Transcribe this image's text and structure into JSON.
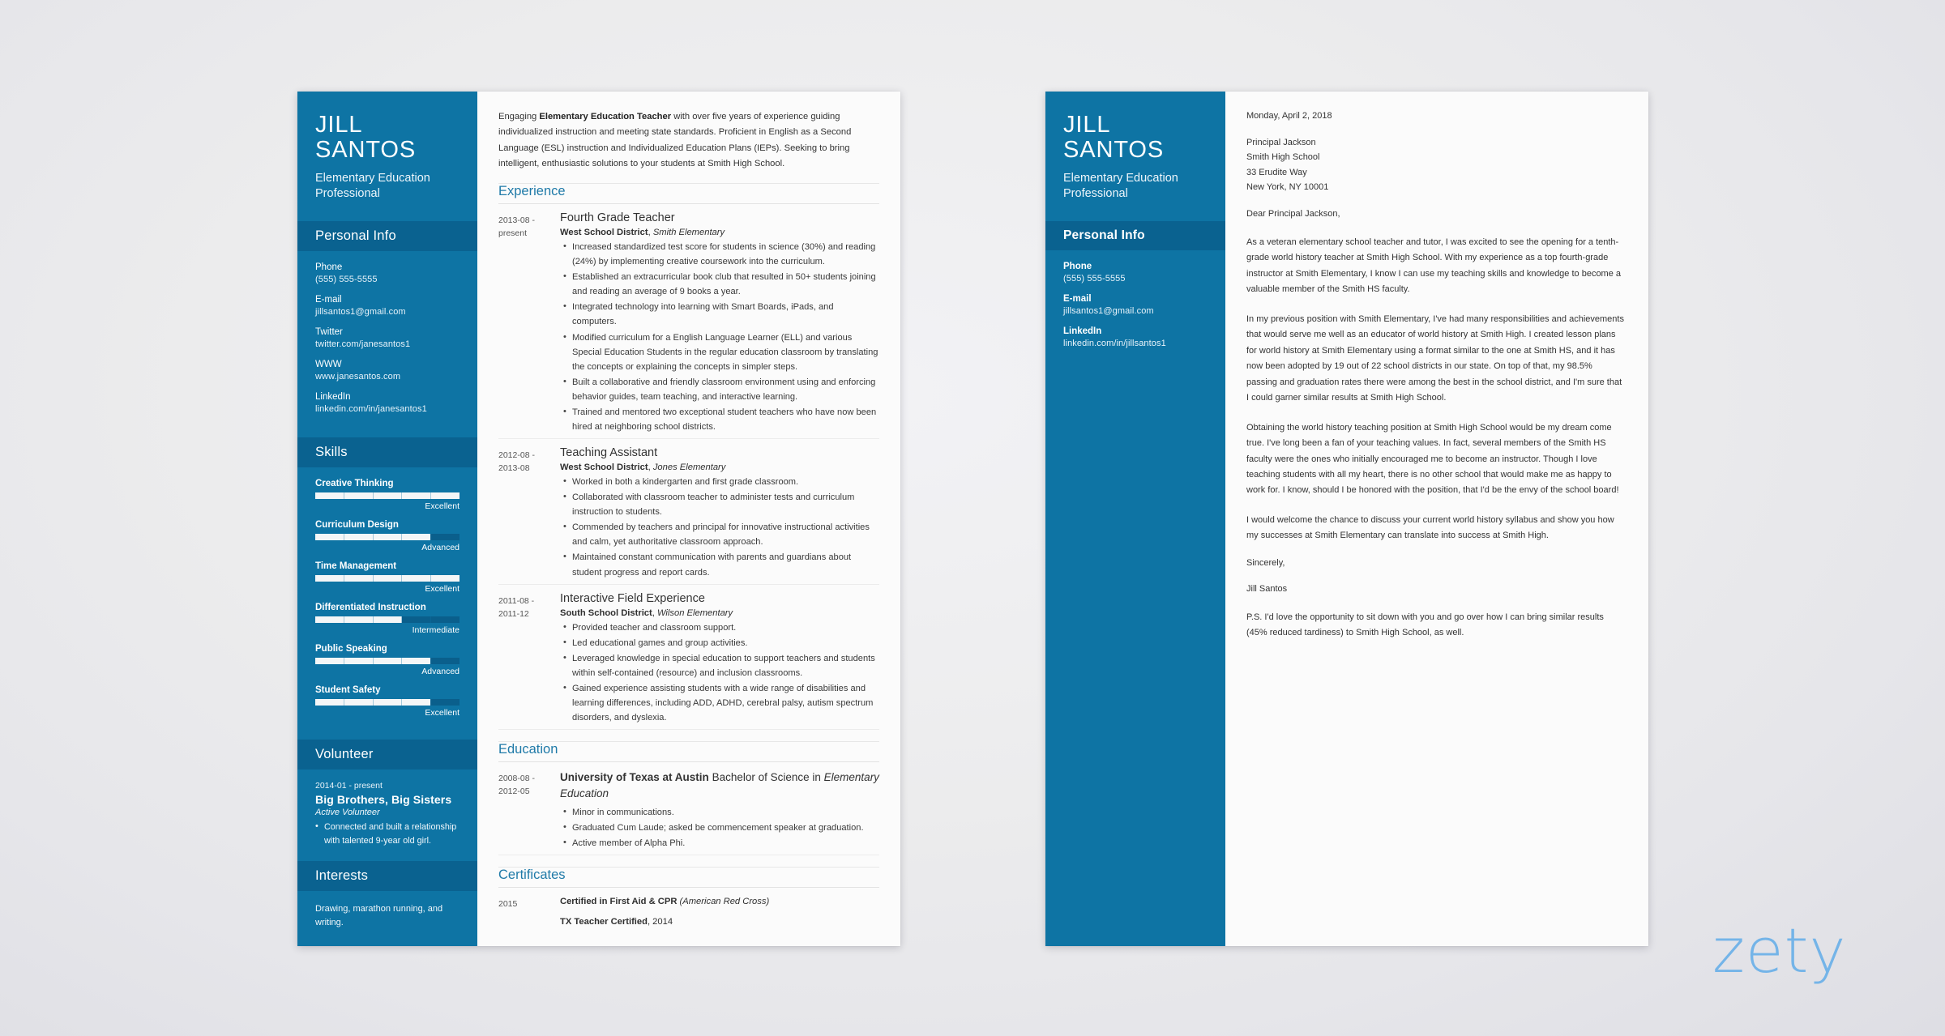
{
  "brand": {
    "logo_text": "zety",
    "logo_color": "#74b4e8"
  },
  "theme": {
    "sidebar_blue": "#0e74a4",
    "band_blue": "#0a6290",
    "accent_heading": "#1f7aa8",
    "page_bg": "#ececee"
  },
  "resume": {
    "sidebar": {
      "name": "JILL SANTOS",
      "role": "Elementary Education Professional",
      "personal_info_title": "Personal Info",
      "contacts": [
        {
          "label": "Phone",
          "value": "(555) 555-5555"
        },
        {
          "label": "E-mail",
          "value": "jillsantos1@gmail.com"
        },
        {
          "label": "Twitter",
          "value": "twitter.com/janesantos1"
        },
        {
          "label": "WWW",
          "value": "www.janesantos.com"
        },
        {
          "label": "LinkedIn",
          "value": "linkedin.com/in/janesantos1"
        }
      ],
      "skills_title": "Skills",
      "skills": [
        {
          "name": "Creative Thinking",
          "level": "Excellent",
          "percent": 100
        },
        {
          "name": "Curriculum Design",
          "level": "Advanced",
          "percent": 80
        },
        {
          "name": "Time Management",
          "level": "Excellent",
          "percent": 100
        },
        {
          "name": "Differentiated Instruction",
          "level": "Intermediate",
          "percent": 60
        },
        {
          "name": "Public Speaking",
          "level": "Advanced",
          "percent": 80
        },
        {
          "name": "Student Safety",
          "level": "Excellent",
          "percent": 80
        }
      ],
      "volunteer_title": "Volunteer",
      "volunteer": {
        "date": "2014-01 - present",
        "org": "Big Brothers, Big Sisters",
        "role": "Active Volunteer",
        "bullets": [
          "Connected and built a relationship with talented 9-year old girl."
        ]
      },
      "interests_title": "Interests",
      "interests_text": "Drawing, marathon running, and writing."
    },
    "summary": {
      "pre": "Engaging ",
      "bold": "Elementary Education Teacher",
      "post": " with over five years of experience guiding individualized instruction and meeting state standards. Proficient in English as a Second Language (ESL) instruction and Individualized Education Plans (IEPs). Seeking to bring intelligent, enthusiastic solutions to your students at Smith High School."
    },
    "experience_title": "Experience",
    "experience": [
      {
        "date": "2013-08 - present",
        "title": "Fourth Grade Teacher",
        "employer": "West School District",
        "location": "Smith Elementary",
        "bullets": [
          "Increased standardized test score for students in science (30%) and reading (24%) by implementing creative coursework into the curriculum.",
          "Established an extracurricular book club that resulted in 50+ students joining and reading an average of 9 books a year.",
          "Integrated technology into learning with Smart Boards, iPads, and computers.",
          "Modified curriculum for a English Language Learner (ELL) and various Special Education Students in the regular education classroom by translating the concepts or explaining the concepts in simpler steps.",
          "Built a collaborative and friendly classroom environment using and enforcing behavior guides, team teaching, and interactive learning.",
          "Trained and mentored two exceptional student teachers who have now been hired at neighboring school districts."
        ]
      },
      {
        "date": "2012-08 - 2013-08",
        "title": "Teaching Assistant",
        "employer": "West School District",
        "location": "Jones Elementary",
        "bullets": [
          "Worked in both a kindergarten and first grade classroom.",
          "Collaborated with classroom teacher to administer tests and curriculum instruction to students.",
          "Commended by teachers and principal for innovative instructional activities and calm, yet authoritative classroom approach.",
          "Maintained constant communication with parents and guardians about student progress and report cards."
        ]
      },
      {
        "date": "2011-08 - 2011-12",
        "title": "Interactive Field Experience",
        "employer": "South School District",
        "location": "Wilson Elementary",
        "bullets": [
          "Provided teacher and classroom support.",
          "Led educational games and group activities.",
          "Leveraged knowledge in special education to support teachers and students within self-contained (resource) and inclusion classrooms.",
          "Gained experience assisting students with a wide range of disabilities and learning differences, including ADD, ADHD, cerebral palsy, autism spectrum disorders, and dyslexia."
        ]
      }
    ],
    "education_title": "Education",
    "education": [
      {
        "date": "2008-08 - 2012-05",
        "school": "University of Texas at Austin",
        "degree": " Bachelor of Science in ",
        "field": "Elementary Education",
        "bullets": [
          "Minor in communications.",
          "Graduated Cum Laude; asked be commencement speaker at graduation.",
          "Active member of Alpha Phi."
        ]
      }
    ],
    "certificates_title": "Certificates",
    "certificates": {
      "date": "2015",
      "items": [
        {
          "bold": "Certified in First Aid & CPR",
          "italic": " (American Red Cross)",
          "plain": ""
        },
        {
          "bold": "TX Teacher Certified",
          "italic": "",
          "plain": ", 2014"
        }
      ]
    }
  },
  "letter": {
    "sidebar": {
      "name": "JILL SANTOS",
      "role": "Elementary Education Professional",
      "personal_info_title": "Personal Info",
      "contacts": [
        {
          "label": "Phone",
          "value": "(555) 555-5555"
        },
        {
          "label": "E-mail",
          "value": "jillsantos1@gmail.com"
        },
        {
          "label": "LinkedIn",
          "value": "linkedin.com/in/jillsantos1"
        }
      ]
    },
    "date": "Monday, April 2, 2018",
    "address": [
      "Principal Jackson",
      "Smith High School",
      "33 Erudite Way",
      "New York, NY 10001"
    ],
    "salutation": "Dear Principal Jackson,",
    "paragraphs": [
      "As a veteran elementary school teacher and tutor, I was excited to see the opening for a tenth-grade world history teacher at Smith High School. With my experience as a top fourth-grade instructor at Smith Elementary, I know I can use my teaching skills and knowledge to become a valuable member of the Smith HS faculty.",
      "In my previous position with Smith Elementary, I've had many responsibilities and achievements that would serve me well as an educator of world history at Smith High. I created lesson plans for world history at Smith Elementary using a format similar to the one at Smith HS, and it has now been adopted by 19 out of 22 school districts in our state. On top of that, my 98.5% passing and graduation rates there were among the best in the school district, and I'm sure that I could garner similar results at Smith High School.",
      "Obtaining the world history teaching position at Smith High School would be my dream come true. I've long been a fan of your teaching values. In fact, several members of the Smith HS faculty were the ones who initially encouraged me to become an instructor. Though I love teaching students with all my heart, there is no other school that would make me as happy to work for. I know, should I be honored with the position, that I'd be the envy of the school board!",
      "I would welcome the chance to discuss your current world history syllabus and show you how my successes at Smith Elementary can translate into success at Smith High."
    ],
    "closing": "Sincerely,",
    "signature": "Jill Santos",
    "postscript": "P.S. I'd love the opportunity to sit down with you and go over how I can bring similar results (45% reduced tardiness) to Smith High School, as well."
  }
}
